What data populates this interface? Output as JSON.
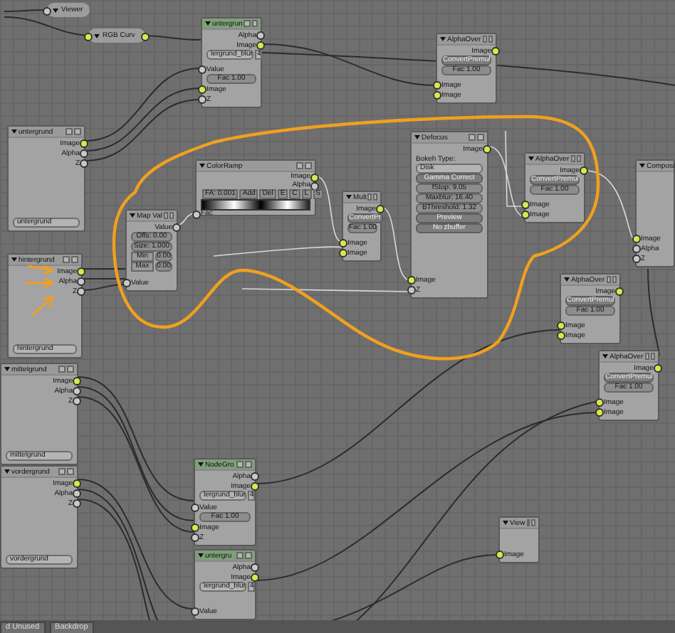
{
  "nodes": [
    {
      "kind": "collapsed",
      "title": "Viewer",
      "rows": [
        {
          "kind": "input",
          "color": "#c8c8c8"
        }
      ]
    },
    {
      "kind": "collapsed",
      "title": "RGB Curv",
      "rows": [
        {
          "kind": "input",
          "color": "#d8e84a"
        },
        {
          "kind": "output",
          "color": "#d8e84a"
        }
      ]
    },
    {
      "kind": "node",
      "title": "untergrun",
      "color": "#7f9f7a",
      "rows": [
        {
          "kind": "output",
          "text": "Alpha",
          "color": "#c8c8c8"
        },
        {
          "kind": "output",
          "text": "Image",
          "color": "#d8e84a"
        },
        {
          "kind": "dropdown",
          "text": "lergrund_blur",
          "count": "4"
        },
        {
          "kind": "input",
          "text": "Value",
          "color": "#c8c8c8"
        },
        {
          "kind": "field",
          "text": "Fac 1.00"
        },
        {
          "kind": "input",
          "text": "Image",
          "color": "#d8e84a"
        },
        {
          "kind": "input",
          "text": "Z",
          "color": "#c8c8c8"
        }
      ]
    },
    {
      "kind": "node",
      "title": "AlphaOver",
      "rows": [
        {
          "kind": "output",
          "text": "Image",
          "color": "#d8e84a"
        },
        {
          "kind": "button",
          "text": "ConvertPremul"
        },
        {
          "kind": "field",
          "text": "Fac 1.00"
        },
        {
          "kind": "input",
          "text": "Image",
          "color": "#d8e84a"
        },
        {
          "kind": "input",
          "text": "Image",
          "color": "#d8e84a"
        }
      ]
    },
    {
      "kind": "node",
      "title": "untergrund",
      "rows": [
        {
          "kind": "output",
          "text": "Image",
          "color": "#d8e84a"
        },
        {
          "kind": "output",
          "text": "Alpha",
          "color": "#c8c8c8"
        },
        {
          "kind": "output",
          "text": "Z",
          "color": "#c8c8c8"
        },
        {
          "kind": "layer",
          "text": "untergrund"
        }
      ]
    },
    {
      "kind": "node",
      "title": "ColorRamp",
      "rows": [
        {
          "kind": "output",
          "text": "Image",
          "color": "#d8e84a"
        },
        {
          "kind": "output",
          "text": "Alpha",
          "color": "#c8c8c8"
        },
        {
          "kind": "ramp-controls",
          "items": [
            "FA: 0.001",
            "Add",
            "Del",
            "E",
            "C",
            "L",
            "S"
          ]
        },
        {
          "kind": "ramp"
        },
        {
          "kind": "input",
          "text": "Fac",
          "color": "#c8c8c8"
        }
      ]
    },
    {
      "kind": "node",
      "title": "Map Val",
      "rows": [
        {
          "kind": "output",
          "text": "Value",
          "color": "#c8c8c8"
        },
        {
          "kind": "field",
          "text": "Offs: 0.00"
        },
        {
          "kind": "field",
          "text": "Size: 1.000"
        },
        {
          "kind": "pair",
          "label": "Min",
          "text": "0.00"
        },
        {
          "kind": "pair",
          "label": "Max",
          "text": "0.00"
        },
        {
          "kind": "input",
          "text": "Value",
          "color": "#c8c8c8"
        }
      ]
    },
    {
      "kind": "node",
      "title": "hintergrund",
      "rows": [
        {
          "kind": "output",
          "text": "Image",
          "color": "#d8e84a"
        },
        {
          "kind": "output",
          "text": "Alpha",
          "color": "#c8c8c8"
        },
        {
          "kind": "output",
          "text": "Z",
          "color": "#c8c8c8"
        },
        {
          "kind": "layer",
          "text": "hintergrund"
        }
      ]
    },
    {
      "kind": "node",
      "title": "mittelgrund",
      "rows": [
        {
          "kind": "output",
          "text": "Image",
          "color": "#d8e84a"
        },
        {
          "kind": "output",
          "text": "Alpha",
          "color": "#c8c8c8"
        },
        {
          "kind": "output",
          "text": "Z",
          "color": "#c8c8c8"
        },
        {
          "kind": "layer",
          "text": "mittelgrund"
        }
      ]
    },
    {
      "kind": "node",
      "title": "vordergrund",
      "rows": [
        {
          "kind": "output",
          "text": "Image",
          "color": "#d8e84a"
        },
        {
          "kind": "output",
          "text": "Alpha",
          "color": "#c8c8c8"
        },
        {
          "kind": "output",
          "text": "Z",
          "color": "#c8c8c8"
        },
        {
          "kind": "layer",
          "text": "vordergrund"
        }
      ]
    },
    {
      "kind": "node",
      "title": "Defocus",
      "rows": [
        {
          "kind": "output",
          "text": "Image",
          "color": "#d8e84a"
        },
        {
          "kind": "label",
          "text": "Bokeh Type:"
        },
        {
          "kind": "dropdown",
          "text": "Disk"
        },
        {
          "kind": "button",
          "text": "Gamma Correct"
        },
        {
          "kind": "field",
          "text": "fStop: 9.05"
        },
        {
          "kind": "field",
          "text": "Maxblur: 16.40"
        },
        {
          "kind": "field",
          "text": "BThreshold: 1.32"
        },
        {
          "kind": "button",
          "text": "Preview"
        },
        {
          "kind": "button",
          "text": "No zbuffer"
        },
        {
          "kind": "input",
          "text": "Image",
          "color": "#d8e84a"
        },
        {
          "kind": "input",
          "text": "Z",
          "color": "#c8c8c8"
        }
      ]
    },
    {
      "kind": "node",
      "title": "Mult",
      "rows": [
        {
          "kind": "output",
          "text": "Image",
          "color": "#d8e84a"
        },
        {
          "kind": "button",
          "text": "ConvertPr"
        },
        {
          "kind": "field",
          "text": "Fac 1.00"
        },
        {
          "kind": "input",
          "text": "Image",
          "color": "#d8e84a"
        },
        {
          "kind": "input",
          "text": "Image",
          "color": "#d8e84a"
        }
      ]
    },
    {
      "kind": "node",
      "title": "AlphaOver",
      "rows": [
        {
          "kind": "output",
          "text": "Image",
          "color": "#d8e84a"
        },
        {
          "kind": "button",
          "text": "ConvertPremul"
        },
        {
          "kind": "field",
          "text": "Fac 1.00"
        },
        {
          "kind": "input",
          "text": "Image",
          "color": "#d8e84a"
        },
        {
          "kind": "input",
          "text": "Image",
          "color": "#d8e84a"
        }
      ]
    },
    {
      "kind": "node",
      "title": "Composi",
      "rows": [
        {
          "kind": "input",
          "text": "Image",
          "color": "#d8e84a"
        },
        {
          "kind": "input",
          "text": "Alpha",
          "color": "#c8c8c8"
        },
        {
          "kind": "input",
          "text": "Z",
          "color": "#c8c8c8"
        }
      ]
    },
    {
      "kind": "node",
      "title": "AlphaOver",
      "rows": [
        {
          "kind": "output",
          "text": "Image",
          "color": "#d8e84a"
        },
        {
          "kind": "button",
          "text": "ConvertPremul"
        },
        {
          "kind": "field",
          "text": "Fac 1.00"
        },
        {
          "kind": "input",
          "text": "Image",
          "color": "#d8e84a"
        },
        {
          "kind": "input",
          "text": "Image",
          "color": "#d8e84a"
        }
      ]
    },
    {
      "kind": "node",
      "title": "AlphaOver",
      "rows": [
        {
          "kind": "output",
          "text": "Image",
          "color": "#d8e84a"
        },
        {
          "kind": "button",
          "text": "ConvertPremul"
        },
        {
          "kind": "field",
          "text": "Fac 1.00"
        },
        {
          "kind": "input",
          "text": "Image",
          "color": "#d8e84a"
        },
        {
          "kind": "input",
          "text": "Image",
          "color": "#d8e84a"
        }
      ]
    },
    {
      "kind": "node",
      "title": "NodeGro",
      "color": "#7f9f7a",
      "rows": [
        {
          "kind": "output",
          "text": "Alpha",
          "color": "#c8c8c8"
        },
        {
          "kind": "output",
          "text": "Image",
          "color": "#d8e84a"
        },
        {
          "kind": "dropdown",
          "text": "lergrund_blur",
          "count": "4"
        },
        {
          "kind": "input",
          "text": "Value",
          "color": "#c8c8c8"
        },
        {
          "kind": "field",
          "text": "Fac 1.00"
        },
        {
          "kind": "input",
          "text": "Image",
          "color": "#d8e84a"
        },
        {
          "kind": "input",
          "text": "Z",
          "color": "#c8c8c8"
        }
      ]
    },
    {
      "kind": "node",
      "title": "untergru",
      "color": "#7f9f7a",
      "rows": [
        {
          "kind": "output",
          "text": "Alpha",
          "color": "#c8c8c8"
        },
        {
          "kind": "output",
          "text": "Image",
          "color": "#d8e84a"
        },
        {
          "kind": "dropdown",
          "text": "lergrund_blur",
          "count": "4"
        },
        {
          "kind": "input",
          "text": "Value",
          "color": "#c8c8c8"
        }
      ]
    },
    {
      "kind": "node",
      "title": "View",
      "rows": [
        {
          "kind": "input",
          "text": "Image",
          "color": "#d8e84a"
        }
      ]
    }
  ],
  "bottom_tabs": [
    "d Unused",
    "Backdrop"
  ]
}
